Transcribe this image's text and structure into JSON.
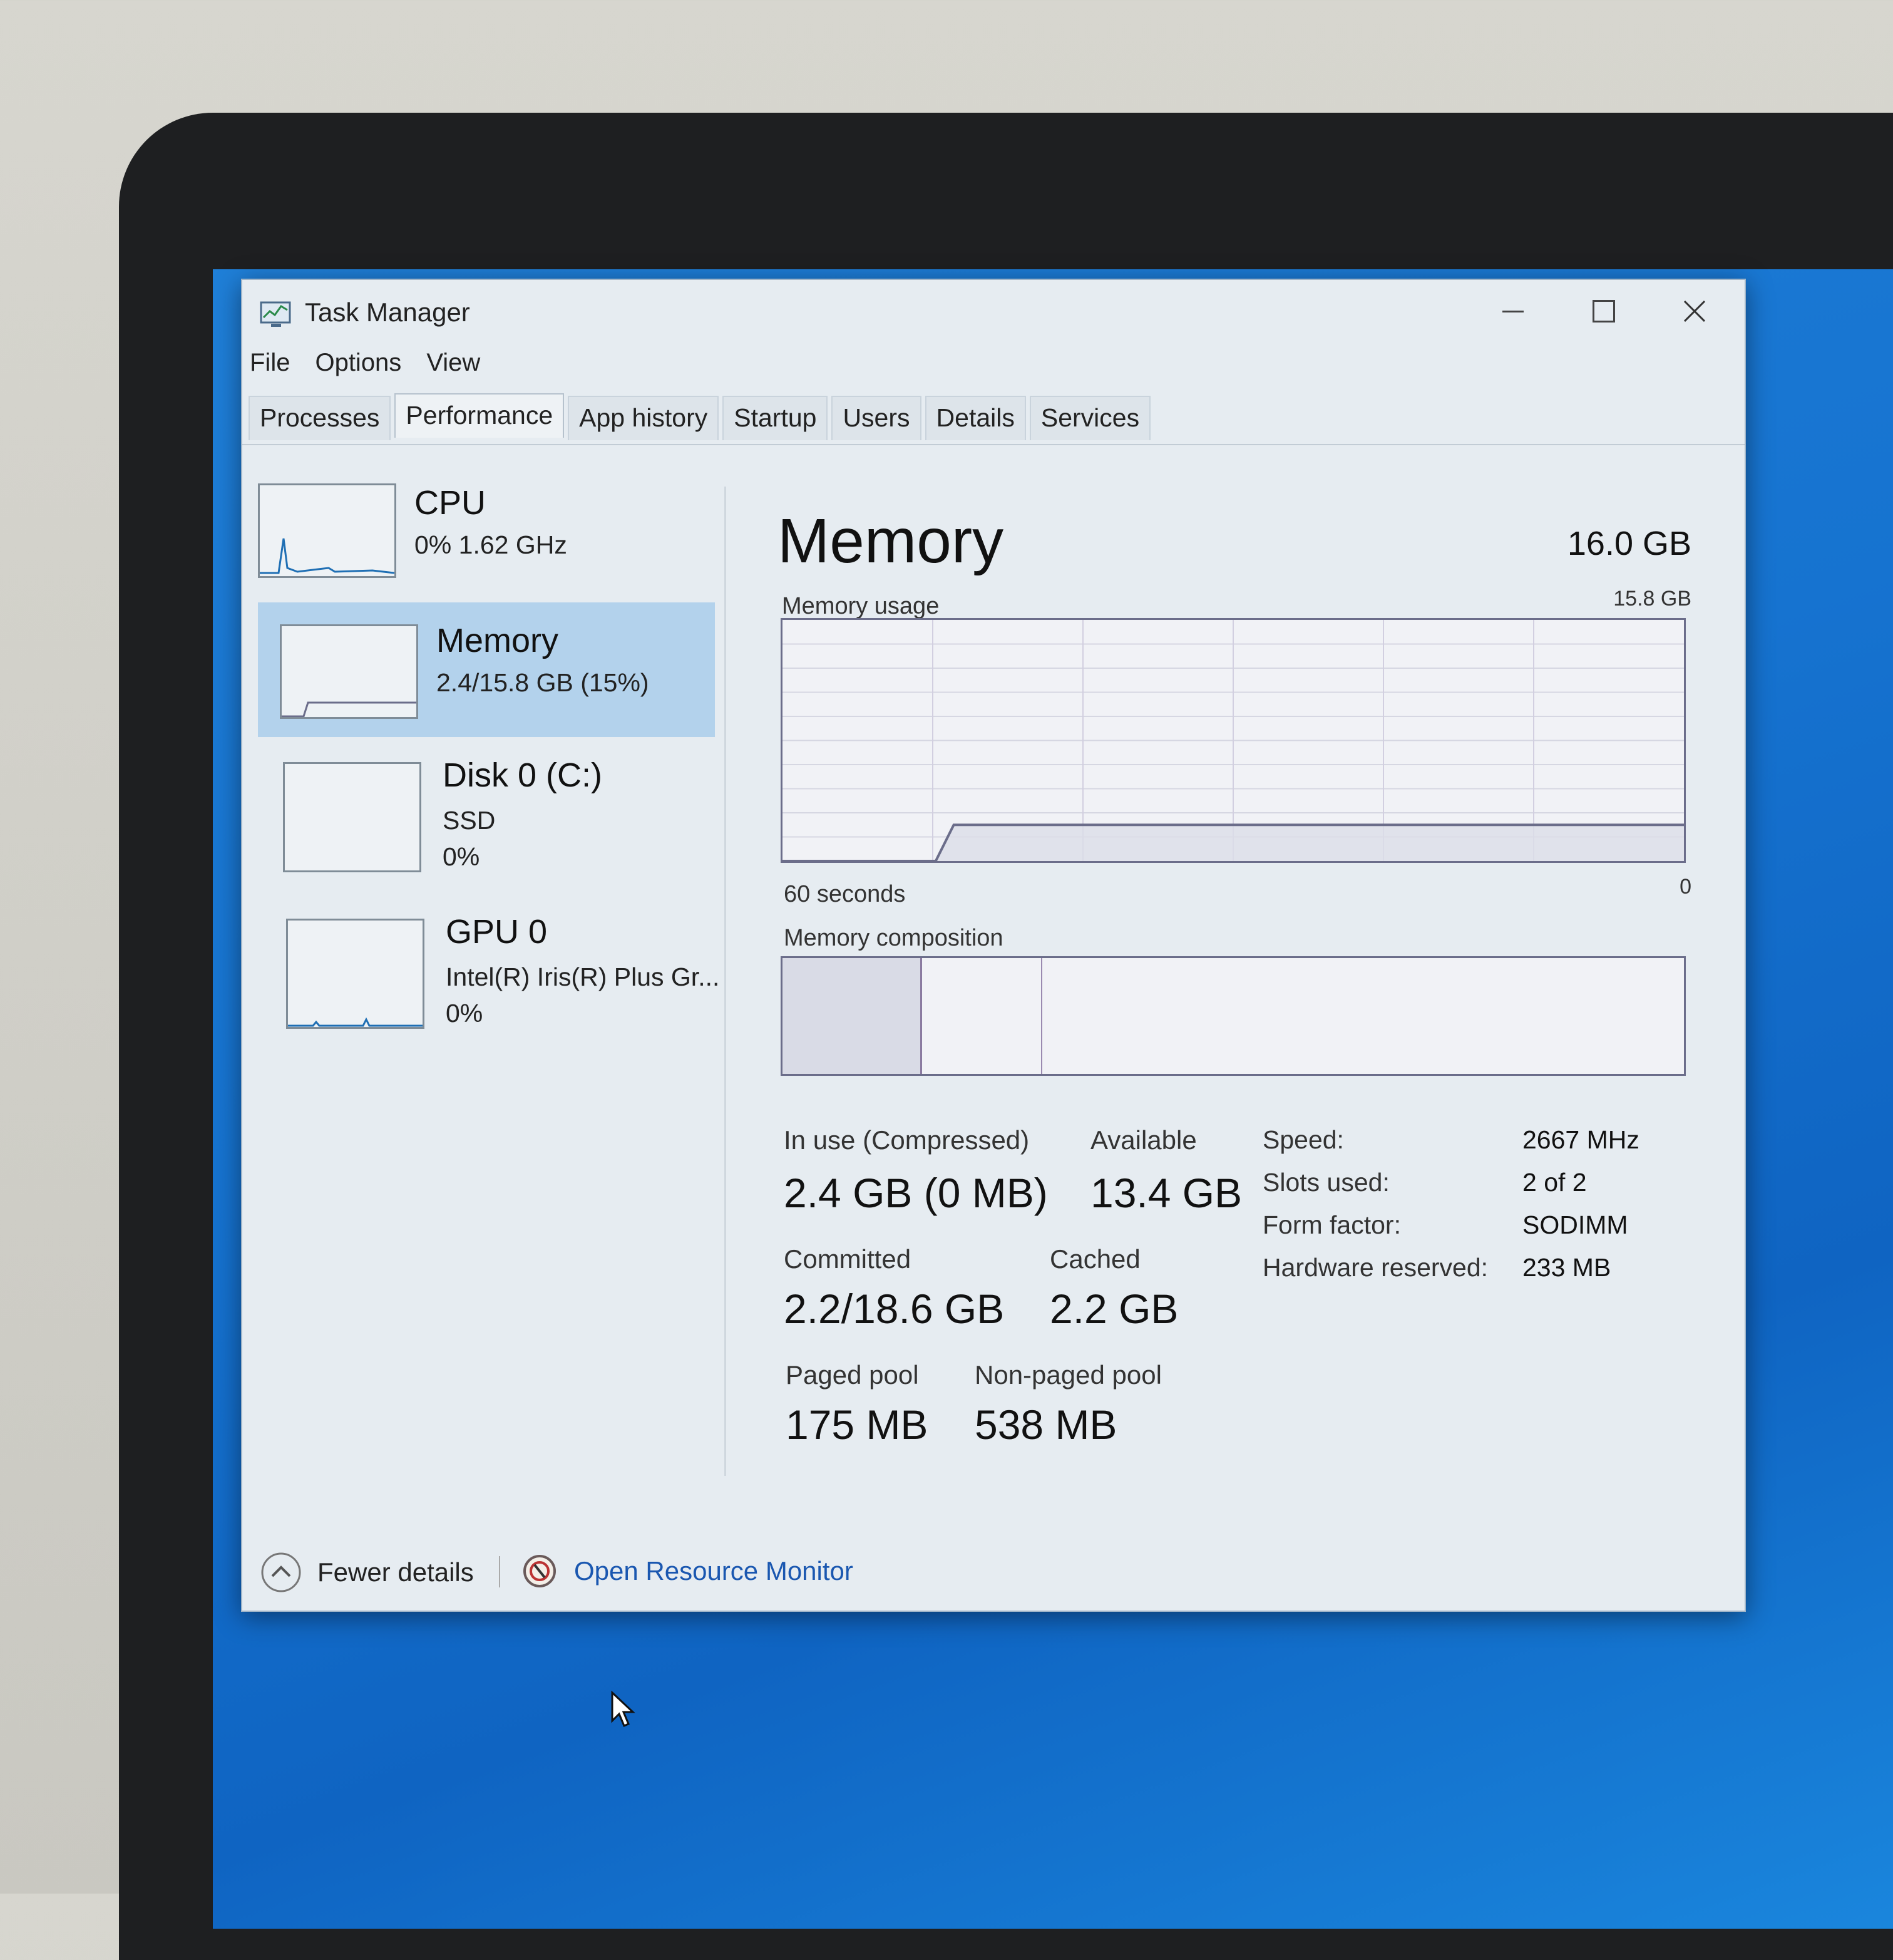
{
  "window": {
    "title": "Task Manager"
  },
  "menu": {
    "file": "File",
    "options": "Options",
    "view": "View"
  },
  "tabs": [
    "Processes",
    "Performance",
    "App history",
    "Startup",
    "Users",
    "Details",
    "Services"
  ],
  "sidebar": {
    "cpu": {
      "name": "CPU",
      "detail": "0%  1.62 GHz"
    },
    "memory": {
      "name": "Memory",
      "detail": "2.4/15.8 GB (15%)"
    },
    "disk": {
      "name": "Disk 0 (C:)",
      "type": "SSD",
      "usage": "0%"
    },
    "gpu": {
      "name": "GPU 0",
      "model": "Intel(R) Iris(R) Plus Gr...",
      "usage": "0%"
    }
  },
  "main": {
    "title": "Memory",
    "total": "16.0 GB",
    "usage_label": "Memory usage",
    "usage_max": "15.8 GB",
    "time_left": "60 seconds",
    "time_right": "0",
    "composition_label": "Memory composition",
    "usage_fraction": 0.15
  },
  "stats": {
    "in_use_label": "In use (Compressed)",
    "in_use_value": "2.4 GB (0 MB)",
    "available_label": "Available",
    "available_value": "13.4 GB",
    "committed_label": "Committed",
    "committed_value": "2.2/18.6 GB",
    "cached_label": "Cached",
    "cached_value": "2.2 GB",
    "paged_label": "Paged pool",
    "paged_value": "175 MB",
    "nonpaged_label": "Non-paged pool",
    "nonpaged_value": "538 MB"
  },
  "info": {
    "speed_label": "Speed:",
    "speed_value": "2667 MHz",
    "slots_label": "Slots used:",
    "slots_value": "2 of 2",
    "form_label": "Form factor:",
    "form_value": "SODIMM",
    "hw_label": "Hardware reserved:",
    "hw_value": "233 MB"
  },
  "footer": {
    "fewer": "Fewer details",
    "monitor": "Open Resource Monitor"
  },
  "colors": {
    "accent_link": "#1a57b0",
    "selected": "#b3d2ec",
    "graph_line": "#6b6d8a"
  }
}
